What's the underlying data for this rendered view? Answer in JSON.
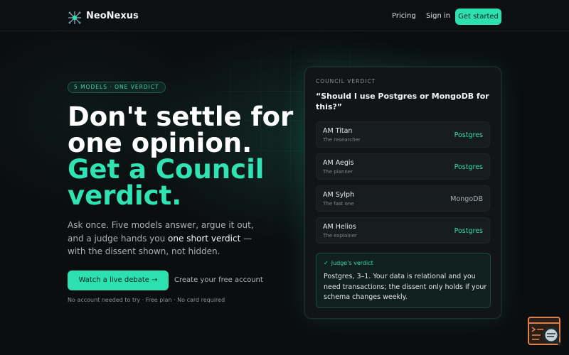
{
  "header": {
    "brand": "NeoNexus",
    "nav": {
      "pricing": "Pricing",
      "signin": "Sign in",
      "cta": "Get started"
    }
  },
  "hero": {
    "badge": "5 MODELS · ONE VERDICT",
    "headline_line1": "Don't settle for",
    "headline_line2": "one opinion.",
    "headline_accent1": "Get a Council",
    "headline_accent2": "verdict.",
    "sub_pre": "Ask once. Five models answer, argue it out, and a judge hands you ",
    "sub_highlight": "one short verdict",
    "sub_post": " — with the dissent shown, not hidden.",
    "watch_button": "Watch a live debate",
    "watch_arrow": "→",
    "create_link": "Create your free account",
    "fine_print": "No account needed to try · Free plan · No card required"
  },
  "card": {
    "label": "COUNCIL VERDICT",
    "question": "“Should I use Postgres or MongoDB for this?”",
    "models": [
      {
        "name": "AM Titan",
        "role": "The researcher",
        "pick": "Postgres",
        "accent": true
      },
      {
        "name": "AM Aegis",
        "role": "The planner",
        "pick": "Postgres",
        "accent": true
      },
      {
        "name": "AM Sylph",
        "role": "The fast one",
        "pick": "MongoDB",
        "accent": false
      },
      {
        "name": "AM Helios",
        "role": "The explainer",
        "pick": "Postgres",
        "accent": true
      }
    ],
    "verdict": {
      "check": "✓",
      "title": "Judge's verdict",
      "text": "Postgres, 3–1. Your data is relational and you need transactions; the dissent only holds if your schema changes weekly."
    }
  },
  "colors": {
    "accent": "#2de0b0",
    "background": "#0b0d0f",
    "card": "#111517"
  },
  "icons": {
    "logo": "network-node-icon",
    "widget": "terminal-search-icon"
  }
}
